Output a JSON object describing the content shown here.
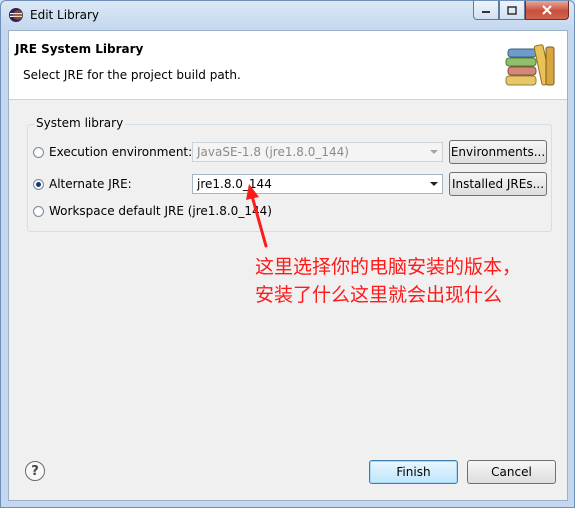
{
  "window": {
    "title": "Edit Library"
  },
  "header": {
    "title": "JRE System Library",
    "description": "Select JRE for the project build path."
  },
  "group": {
    "label": "System library",
    "execution_env": {
      "label": "Execution environment:",
      "value": "JavaSE-1.8 (jre1.8.0_144)",
      "button": "Environments...",
      "selected": false
    },
    "alternate_jre": {
      "label": "Alternate JRE:",
      "value": "jre1.8.0_144",
      "button": "Installed JREs...",
      "selected": true
    },
    "workspace_default": {
      "label": "Workspace default JRE (jre1.8.0_144)",
      "selected": false
    }
  },
  "annotation": {
    "line1": "这里选择你的电脑安装的版本，",
    "line2": "安装了什么这里就会出现什么",
    "color": "#ff1a1a"
  },
  "footer": {
    "help_label": "?",
    "finish": "Finish",
    "cancel": "Cancel"
  }
}
